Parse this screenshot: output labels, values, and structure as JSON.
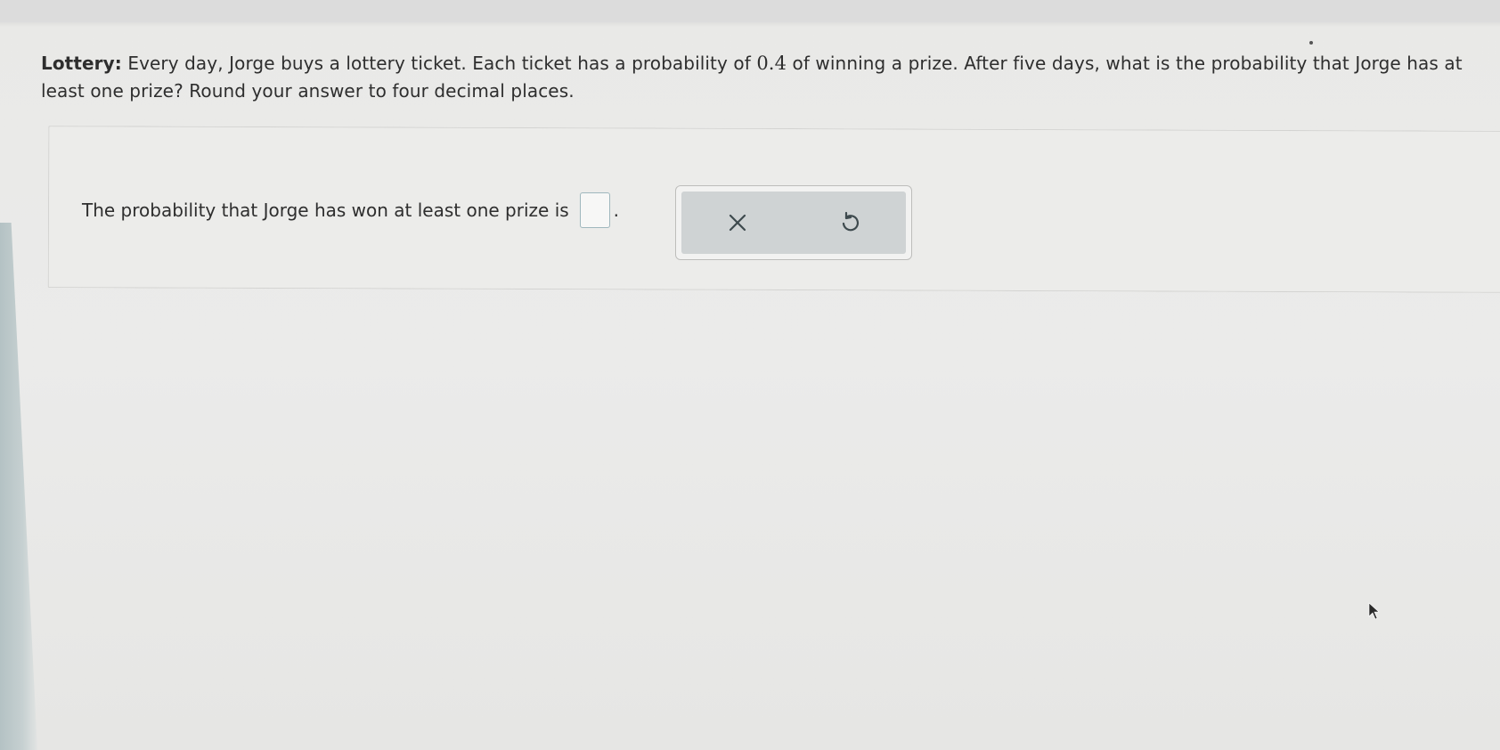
{
  "question": {
    "label": "Lottery:",
    "text_before": " Every day, Jorge buys a lottery ticket. Each ticket has a probability of ",
    "probability": "0.4",
    "text_after": " of winning a prize. After five days, what is the probability that Jorge has at least one prize? Round your answer to four decimal places."
  },
  "answer": {
    "prompt": "The probability that Jorge has won at least one prize is",
    "input_value": "",
    "period": "."
  },
  "tools": {
    "clear_icon": "close-icon",
    "undo_icon": "undo-icon",
    "icon_color": "#3e4a4e",
    "panel_color": "#cfd3d4"
  }
}
